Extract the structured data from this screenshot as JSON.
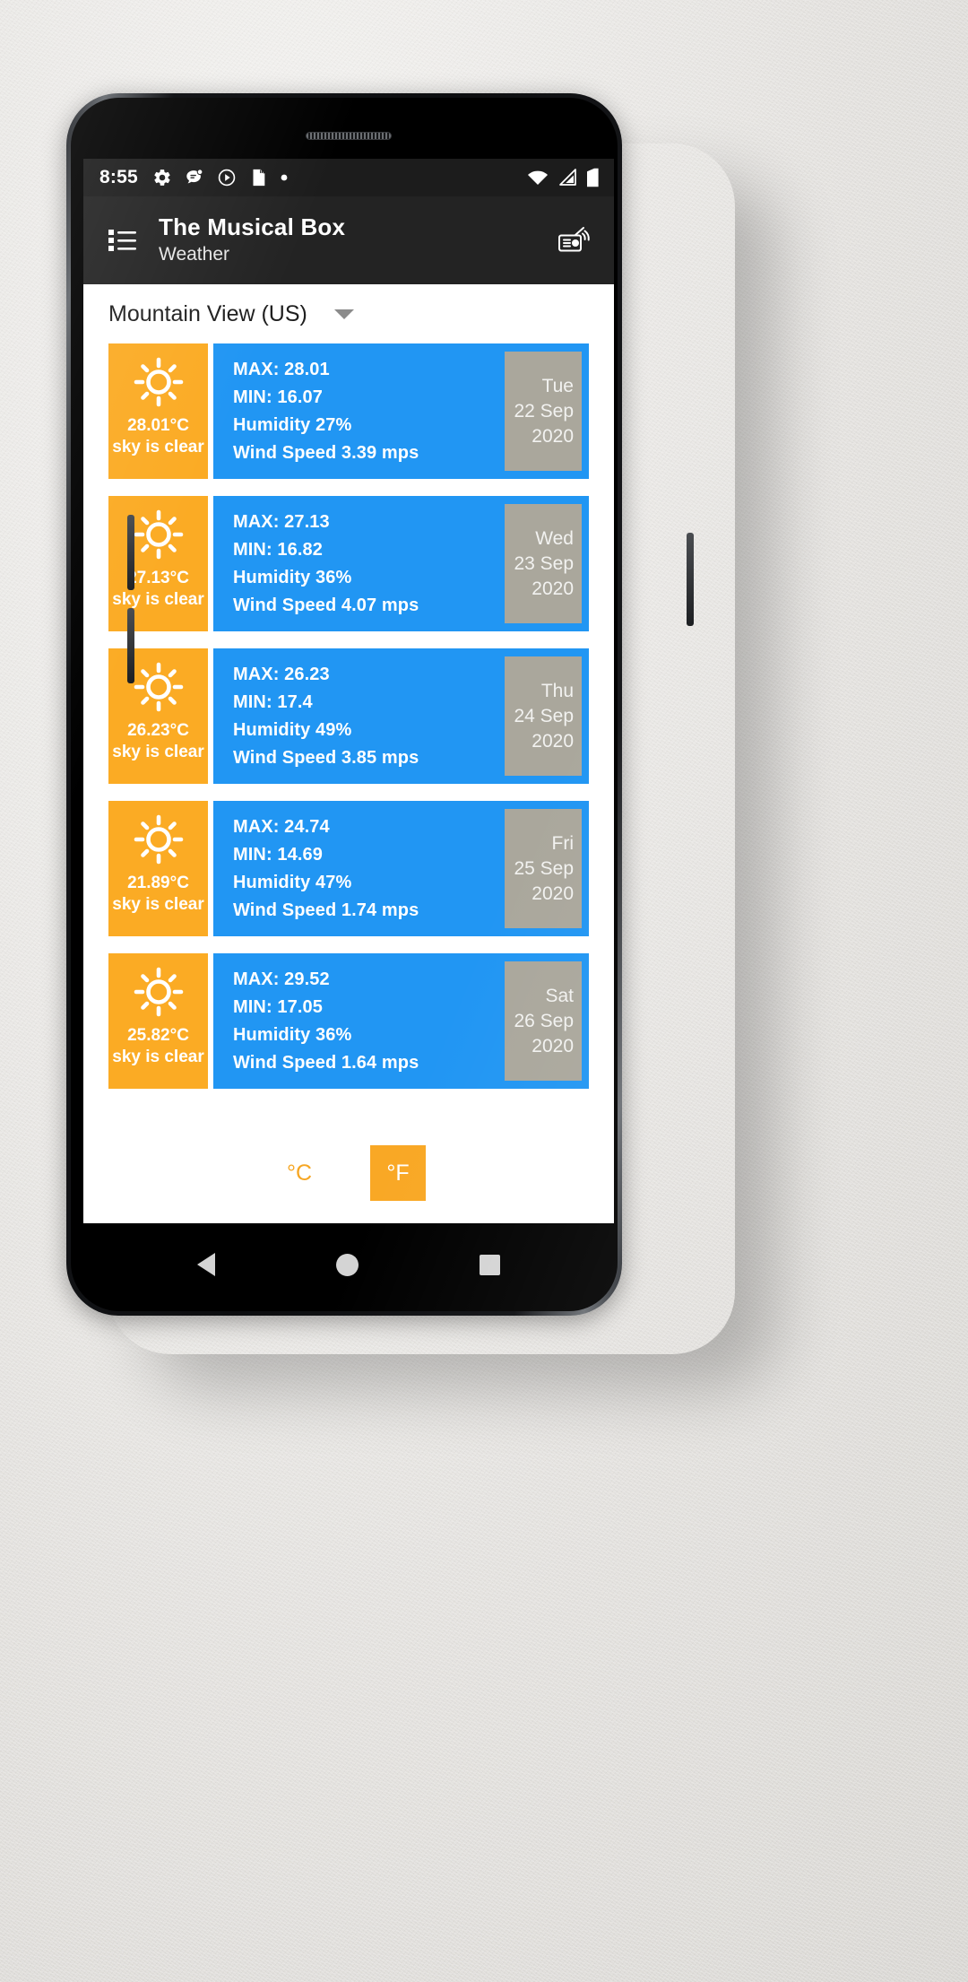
{
  "statusbar": {
    "time": "8:55",
    "left_icons": [
      "gear-icon",
      "message-icon",
      "play-circle-icon",
      "sd-card-icon",
      "dot-icon"
    ],
    "right_icons": [
      "wifi-icon",
      "cellular-signal-icon",
      "battery-icon"
    ]
  },
  "appbar": {
    "menu_icon": "list-menu-icon",
    "title": "The Musical Box",
    "subtitle": "Weather",
    "action_icon": "radio-icon"
  },
  "location": {
    "selected": "Mountain View (US)",
    "caret_icon": "chevron-down-icon"
  },
  "forecast": {
    "labels": {
      "max": "MAX:",
      "min": "MIN:",
      "humidity": "Humidity",
      "wind": "Wind Speed",
      "wind_unit": "mps",
      "percent": "%"
    },
    "cards": [
      {
        "icon": "sun-icon",
        "temp": "28.01°C",
        "desc": "sky is clear",
        "max_line": "MAX: 28.01",
        "min_line": "MIN: 16.07",
        "humidity_line": "Humidity 27%",
        "wind_line": "Wind Speed 3.39 mps",
        "weekday": "Tue",
        "daymonth": "22 Sep",
        "year": "2020"
      },
      {
        "icon": "sun-icon",
        "temp": "27.13°C",
        "desc": "sky is clear",
        "max_line": "MAX: 27.13",
        "min_line": "MIN: 16.82",
        "humidity_line": "Humidity 36%",
        "wind_line": "Wind Speed 4.07 mps",
        "weekday": "Wed",
        "daymonth": "23 Sep",
        "year": "2020"
      },
      {
        "icon": "sun-icon",
        "temp": "26.23°C",
        "desc": "sky is clear",
        "max_line": "MAX: 26.23",
        "min_line": "MIN: 17.4",
        "humidity_line": "Humidity 49%",
        "wind_line": "Wind Speed 3.85 mps",
        "weekday": "Thu",
        "daymonth": "24 Sep",
        "year": "2020"
      },
      {
        "icon": "sun-icon",
        "temp": "21.89°C",
        "desc": "sky is clear",
        "max_line": "MAX: 24.74",
        "min_line": "MIN: 14.69",
        "humidity_line": "Humidity 47%",
        "wind_line": "Wind Speed 1.74 mps",
        "weekday": "Fri",
        "daymonth": "25 Sep",
        "year": "2020"
      },
      {
        "icon": "sun-icon",
        "temp": "25.82°C",
        "desc": "sky is clear",
        "max_line": "MAX: 29.52",
        "min_line": "MIN: 17.05",
        "humidity_line": "Humidity 36%",
        "wind_line": "Wind Speed 1.64 mps",
        "weekday": "Sat",
        "daymonth": "26 Sep",
        "year": "2020"
      }
    ]
  },
  "units": {
    "celsius_label": "°C",
    "fahrenheit_label": "°F",
    "selected": "°F"
  },
  "navbar": {
    "back": "back-button",
    "home": "home-button",
    "recents": "recents-button"
  },
  "colors": {
    "accent_orange": "#f9a825",
    "card_blue": "#2196f3",
    "date_gray": "#aaa79c",
    "appbar": "#232323",
    "statusbar": "#1c1c1c"
  }
}
